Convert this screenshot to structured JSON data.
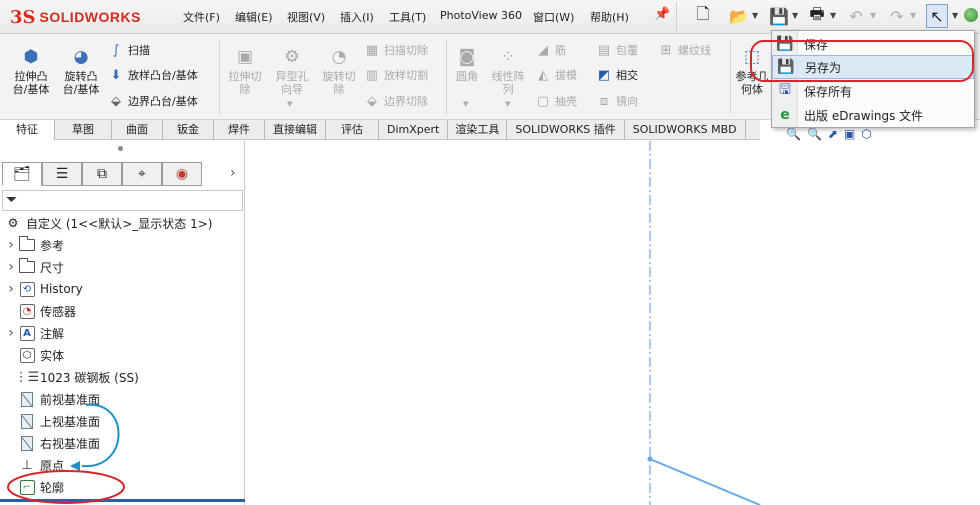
{
  "app": {
    "logo_ds": "3S",
    "logo_name": "SOLIDWORKS"
  },
  "menu": [
    {
      "label": "文件(F)"
    },
    {
      "label": "编辑(E)"
    },
    {
      "label": "视图(V)"
    },
    {
      "label": "插入(I)"
    },
    {
      "label": "工具(T)"
    },
    {
      "label": "PhotoView 360"
    },
    {
      "label": "窗口(W)"
    },
    {
      "label": "帮助(H)"
    }
  ],
  "ribbon": {
    "extrude_boss": "拉伸凸\n台/基体",
    "revolve_boss": "旋转凸\n台/基体",
    "sweep": "扫描",
    "loft_boss": "放样凸台/基体",
    "boundary_boss": "边界凸台/基体",
    "extrude_cut": "拉伸切\n除",
    "hole_wizard": "异型孔\n向导",
    "revolve_cut": "旋转切\n除",
    "swept_cut": "扫描切除",
    "lofted_cut": "放样切割",
    "boundary_cut": "边界切除",
    "fillet": "圆角",
    "linear_pattern": "线性阵\n列",
    "rib": "筋",
    "draft": "拔模",
    "shell": "抽壳",
    "wrap": "包覆",
    "intersect": "相交",
    "mirror": "镜向",
    "thread": "螺纹线",
    "ref_geometry": "参考几\n何体"
  },
  "tabs": [
    "特征",
    "草图",
    "曲面",
    "钣金",
    "焊件",
    "直接编辑",
    "评估",
    "DimXpert",
    "渲染工具",
    "SOLIDWORKS 插件",
    "SOLIDWORKS MBD"
  ],
  "save_menu": {
    "save": "保存",
    "save_as": "另存为",
    "save_all": "保存所有",
    "publish_edrawings": "出版 eDrawings 文件"
  },
  "tree": {
    "root": "自定义 (1<<默认>_显示状态 1>)",
    "items": [
      {
        "label": "参考",
        "expandable": true,
        "icon": "folder-icon"
      },
      {
        "label": "尺寸",
        "expandable": true,
        "icon": "folder-icon"
      },
      {
        "label": "History",
        "expandable": true,
        "icon": "history-icon"
      },
      {
        "label": "传感器",
        "expandable": false,
        "icon": "sensor-icon"
      },
      {
        "label": "注解",
        "expandable": true,
        "icon": "annotation-icon"
      },
      {
        "label": "实体",
        "expandable": false,
        "icon": "solid-body-icon"
      },
      {
        "label": "1023 碳钢板 (SS)",
        "expandable": false,
        "icon": "material-icon"
      },
      {
        "label": "前视基准面",
        "expandable": false,
        "icon": "plane-icon"
      },
      {
        "label": "上视基准面",
        "expandable": false,
        "icon": "plane-icon"
      },
      {
        "label": "右视基准面",
        "expandable": false,
        "icon": "plane-icon"
      },
      {
        "label": "原点",
        "expandable": false,
        "icon": "origin-icon"
      },
      {
        "label": "轮廓",
        "expandable": false,
        "icon": "sketch-icon"
      }
    ]
  },
  "colors": {
    "brand_red": "#d52b1e",
    "highlight_red": "#d8262c",
    "annotation_blue": "#1f8fc9",
    "sketch_blue": "#63a9e8",
    "axis_blue": "#5a8fd8"
  }
}
